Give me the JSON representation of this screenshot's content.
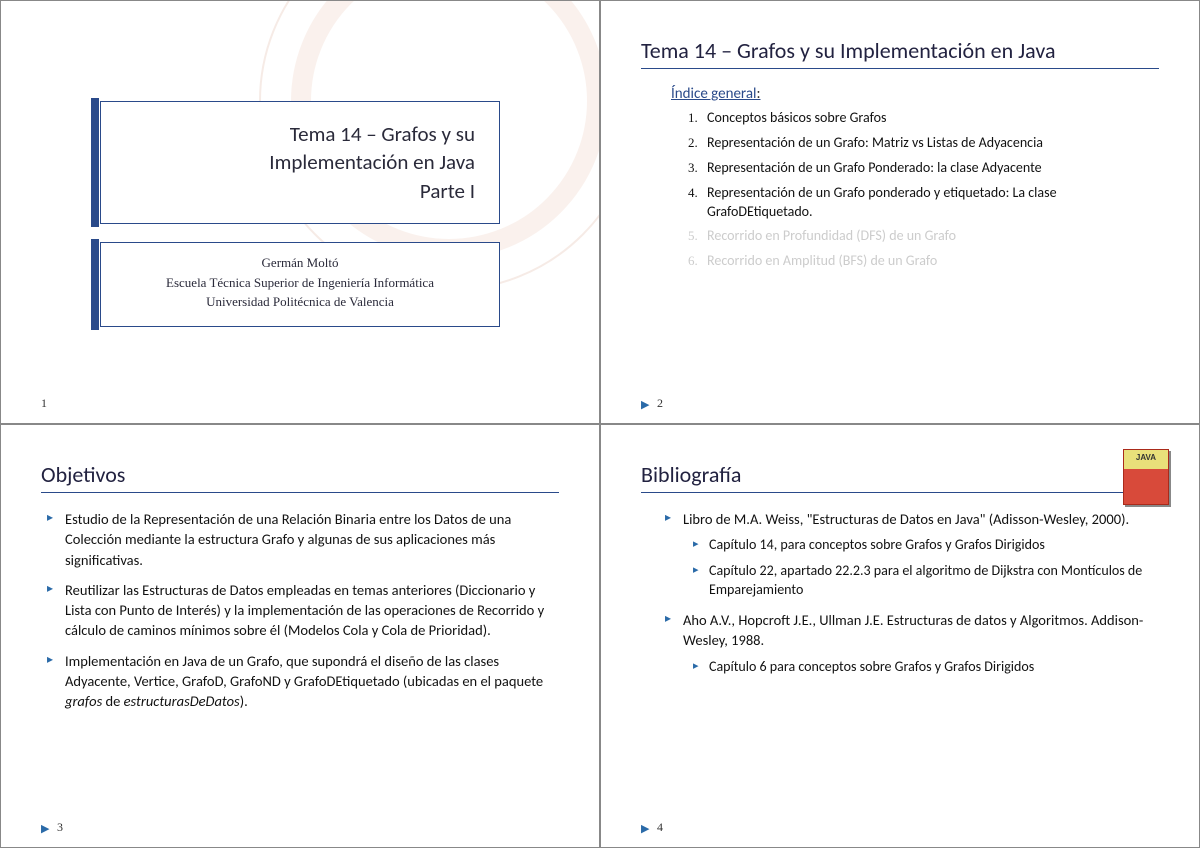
{
  "slide1": {
    "title_line1": "Tema 14 – Grafos y su",
    "title_line2": "Implementación en Java",
    "title_line3": "Parte I",
    "author": "Germán Moltó",
    "affil1": "Escuela Técnica Superior de Ingeniería Informática",
    "affil2": "Universidad Politécnica de Valencia",
    "page": "1"
  },
  "slide2": {
    "heading": "Tema 14 – Grafos y su Implementación en Java",
    "index_label": "Índice general",
    "items": [
      {
        "text": "Conceptos básicos sobre Grafos",
        "dim": false
      },
      {
        "text": "Representación de un Grafo: Matriz vs Listas de Adyacencia",
        "dim": false
      },
      {
        "text": "Representación de un Grafo Ponderado: la clase Adyacente",
        "dim": false
      },
      {
        "text": "Representación de un Grafo ponderado y etiquetado: La clase GrafoDEtiquetado.",
        "dim": false
      },
      {
        "text": "Recorrido en Profundidad (DFS)  de un Grafo",
        "dim": true
      },
      {
        "text": "Recorrido en Amplitud (BFS) de un Grafo",
        "dim": true
      }
    ],
    "page": "2"
  },
  "slide3": {
    "heading": "Objetivos",
    "bullets": [
      "Estudio de la Representación de una Relación Binaria entre los Datos de una Colección mediante la estructura Grafo y algunas de sus aplicaciones más significativas.",
      "Reutilizar las Estructuras de Datos empleadas en temas anteriores (Diccionario y Lista con Punto de Interés) y la implementación de las operaciones de Recorrido y cálculo de caminos mínimos sobre él (Modelos Cola y Cola de Prioridad).",
      "Implementación en Java de un Grafo, que supondrá el diseño de las clases Adyacente, Vertice, GrafoD, GrafoND y GrafoDEtiquetado (ubicadas en el paquete grafos de estructurasDeDatos)."
    ],
    "page": "3"
  },
  "slide4": {
    "heading": "Bibliografía",
    "entries": [
      {
        "text": "Libro de M.A. Weiss, \"Estructuras de Datos en Java\" (Adisson-Wesley, 2000).",
        "sub": [
          "Capítulo 14, para conceptos sobre Grafos y Grafos Dirigidos",
          "Capítulo 22, apartado 22.2.3 para el algoritmo de Dijkstra con Montículos de Emparejamiento"
        ]
      },
      {
        "text": "Aho A.V., Hopcroft J.E., Ullman J.E. Estructuras de datos y Algoritmos. Addison-Wesley, 1988.",
        "sub": [
          "Capítulo 6 para conceptos sobre Grafos y Grafos Dirigidos"
        ]
      }
    ],
    "page": "4"
  }
}
